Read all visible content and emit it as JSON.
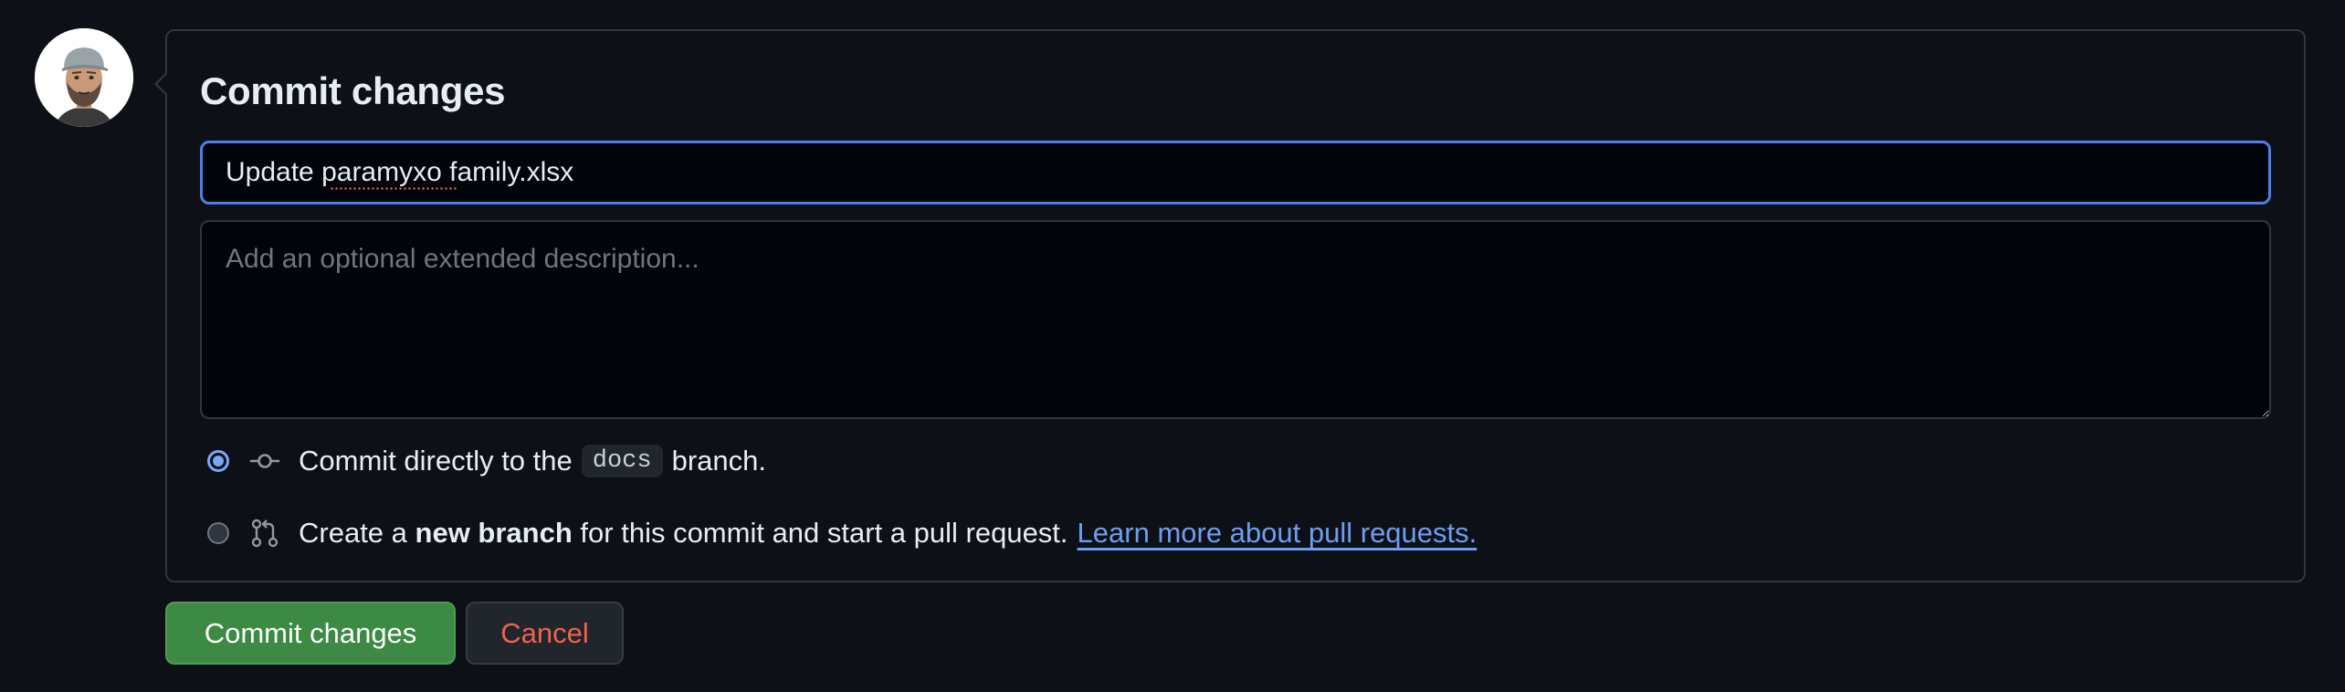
{
  "panel": {
    "title": "Commit changes"
  },
  "summary": {
    "value": "Update paramyxo family.xlsx"
  },
  "description": {
    "placeholder": "Add an optional extended description..."
  },
  "options": {
    "direct": {
      "prefix": "Commit directly to the",
      "branch": "docs",
      "suffix": "branch.",
      "selected": true,
      "icon": "git-commit-icon"
    },
    "new_branch": {
      "prefix": "Create a",
      "bold": "new branch",
      "suffix": "for this commit and start a pull request.",
      "link": "Learn more about pull requests.",
      "selected": false,
      "icon": "git-pull-request-icon"
    }
  },
  "buttons": {
    "commit": "Commit changes",
    "cancel": "Cancel"
  },
  "colors": {
    "background": "#0d1117",
    "accent_blue": "#4f7fe8",
    "commit_green": "#3c8a44",
    "cancel_red": "#f0624d",
    "link_blue": "#6d9df3"
  }
}
